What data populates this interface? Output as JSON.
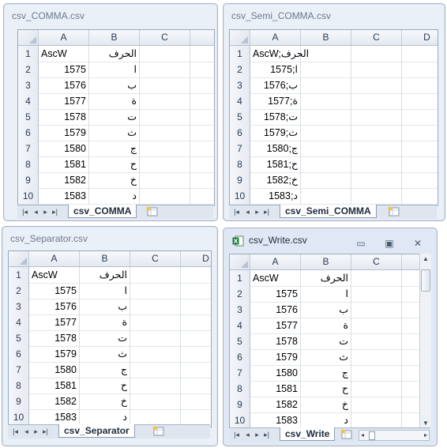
{
  "windows": [
    {
      "title": "csv_COMMA.csv",
      "columns": [
        "A",
        "B",
        "C"
      ],
      "rows": [
        {
          "n": "1",
          "a": "AscW",
          "b": "الحرف"
        },
        {
          "n": "2",
          "a": "1575",
          "b": "ا"
        },
        {
          "n": "3",
          "a": "1576",
          "b": "ب"
        },
        {
          "n": "4",
          "a": "1577",
          "b": "ة"
        },
        {
          "n": "5",
          "a": "1578",
          "b": "ت"
        },
        {
          "n": "6",
          "a": "1579",
          "b": "ث"
        },
        {
          "n": "7",
          "a": "1580",
          "b": "ج"
        },
        {
          "n": "8",
          "a": "1581",
          "b": "ح"
        },
        {
          "n": "9",
          "a": "1582",
          "b": "خ"
        },
        {
          "n": "10",
          "a": "1583",
          "b": "د"
        }
      ],
      "sheet_tab": "csv_COMMA"
    },
    {
      "title": "csv_Semi_COMMA.csv",
      "columns": [
        "A",
        "B",
        "C",
        "D"
      ],
      "rows": [
        {
          "n": "1",
          "a": "AscW;الحرف"
        },
        {
          "n": "2",
          "a": "1575;ا"
        },
        {
          "n": "3",
          "a": "1576;ب"
        },
        {
          "n": "4",
          "a": "1577;ة"
        },
        {
          "n": "5",
          "a": "1578;ت"
        },
        {
          "n": "6",
          "a": "1579;ث"
        },
        {
          "n": "7",
          "a": "1580;ج"
        },
        {
          "n": "8",
          "a": "1581;ح"
        },
        {
          "n": "9",
          "a": "1582;خ"
        },
        {
          "n": "10",
          "a": "1583;د"
        }
      ],
      "sheet_tab": "csv_Semi_COMMA"
    },
    {
      "title": "csv_Separator.csv",
      "columns": [
        "A",
        "B",
        "C",
        "D"
      ],
      "rows": [
        {
          "n": "1",
          "a": "AscW",
          "b": "الحرف"
        },
        {
          "n": "2",
          "a": "1575",
          "b": "ا"
        },
        {
          "n": "3",
          "a": "1576",
          "b": "ب"
        },
        {
          "n": "4",
          "a": "1577",
          "b": "ة"
        },
        {
          "n": "5",
          "a": "1578",
          "b": "ت"
        },
        {
          "n": "6",
          "a": "1579",
          "b": "ث"
        },
        {
          "n": "7",
          "a": "1580",
          "b": "ج"
        },
        {
          "n": "8",
          "a": "1581",
          "b": "ح"
        },
        {
          "n": "9",
          "a": "1582",
          "b": "خ"
        },
        {
          "n": "10",
          "a": "1583",
          "b": "د"
        }
      ],
      "sheet_tab": "csv_Separator"
    },
    {
      "title": "csv_Write.csv",
      "columns": [
        "A",
        "B",
        "C"
      ],
      "rows": [
        {
          "n": "1",
          "a": "AscW",
          "b": "الحرف"
        },
        {
          "n": "2",
          "a": "1575",
          "b": "ا"
        },
        {
          "n": "3",
          "a": "1576",
          "b": "ب"
        },
        {
          "n": "4",
          "a": "1577",
          "b": "ة"
        },
        {
          "n": "5",
          "a": "1578",
          "b": "ت"
        },
        {
          "n": "6",
          "a": "1579",
          "b": "ث"
        },
        {
          "n": "7",
          "a": "1580",
          "b": "ج"
        },
        {
          "n": "8",
          "a": "1581",
          "b": "ح"
        },
        {
          "n": "9",
          "a": "1582",
          "b": "خ"
        },
        {
          "n": "10",
          "a": "1583",
          "b": "د"
        }
      ],
      "sheet_tab": "csv_Write",
      "controls": {
        "minimize": "▭",
        "restore": "▣",
        "close": "✕"
      }
    }
  ],
  "nav_icons": [
    "first-sheet-icon",
    "prev-sheet-icon",
    "next-sheet-icon",
    "last-sheet-icon"
  ],
  "colors": {
    "excel_green": "#1d7a3a",
    "window_bg": "#eaf0f8"
  }
}
